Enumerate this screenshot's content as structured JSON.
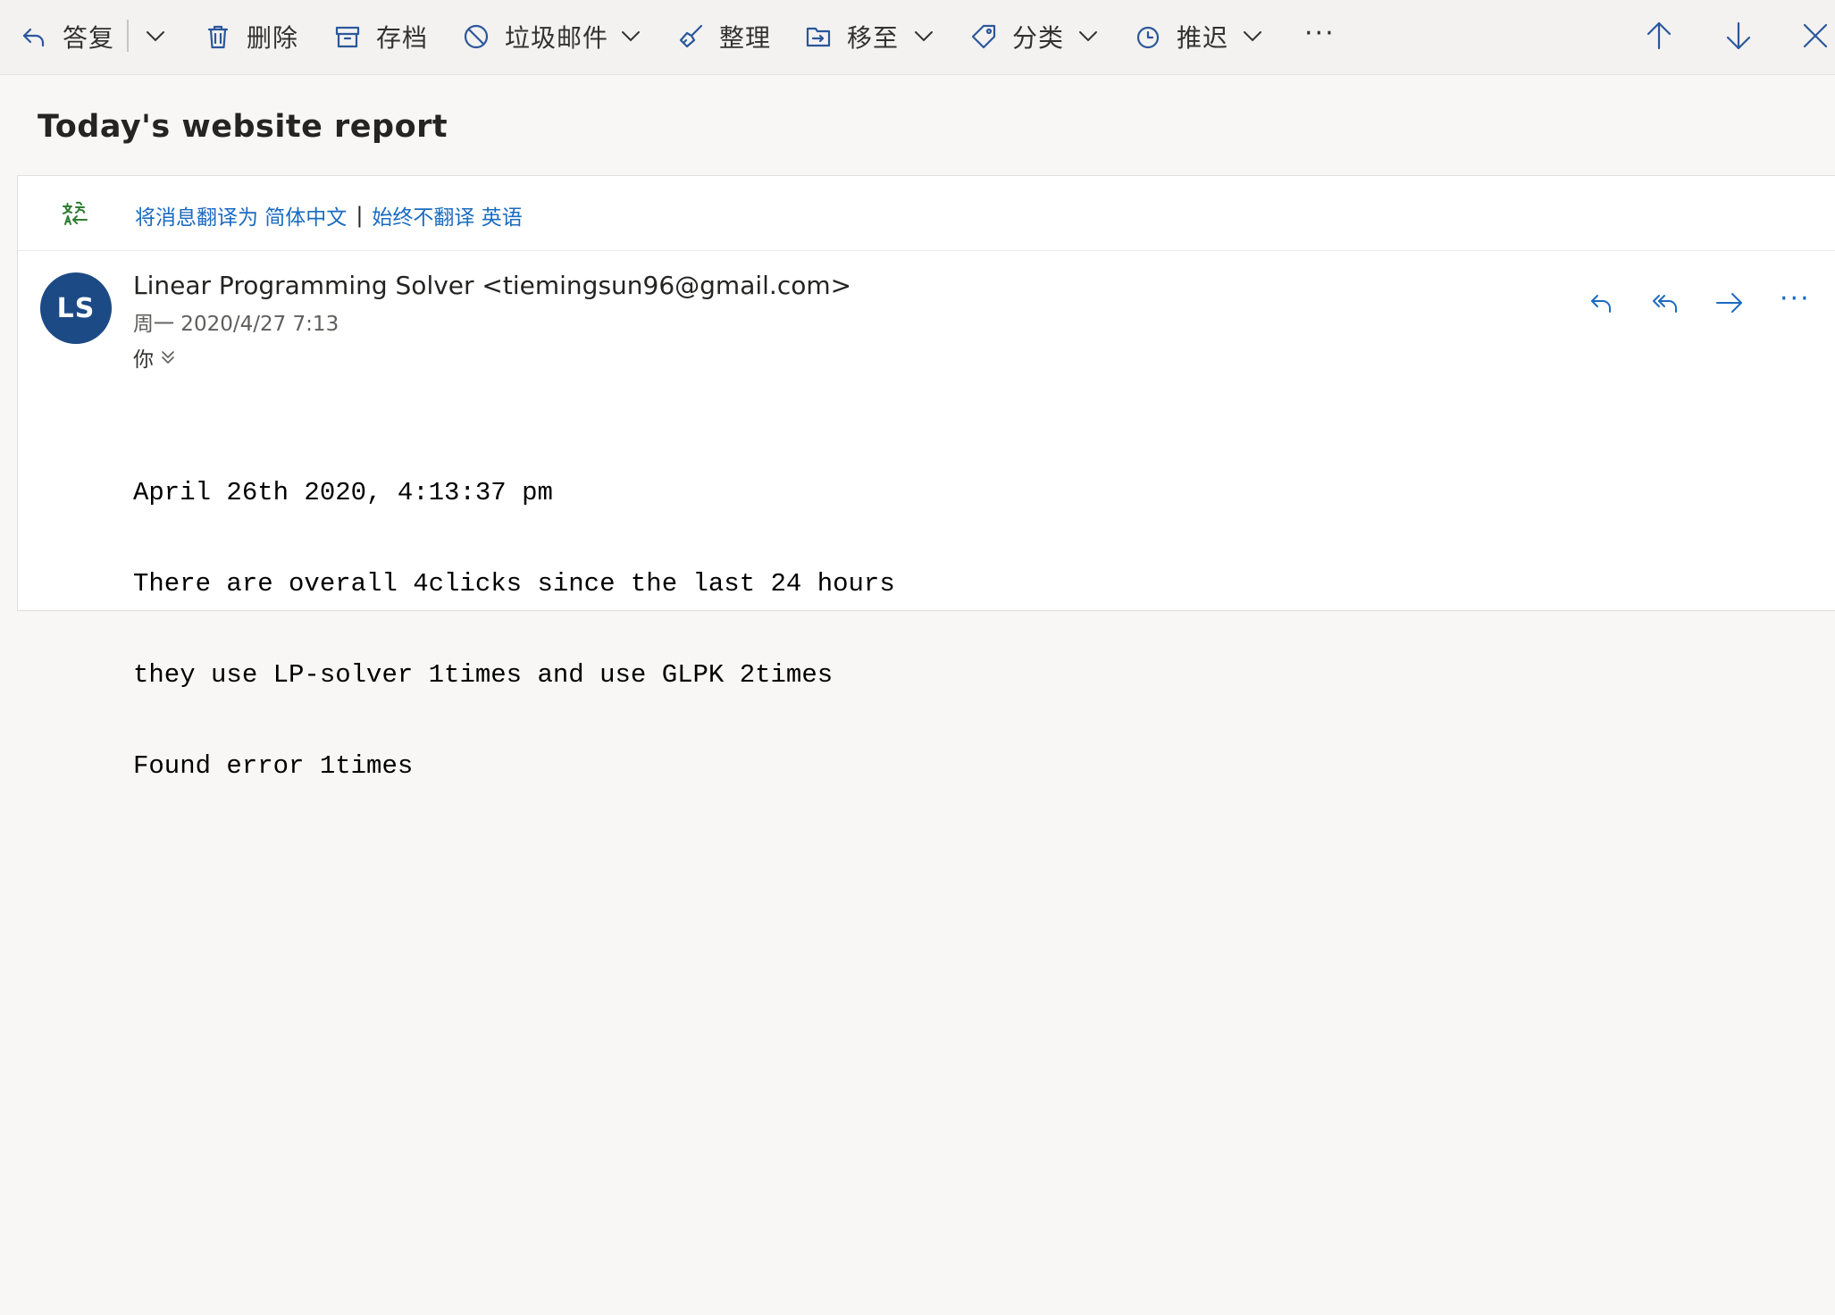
{
  "toolbar": {
    "reply_label": "答复",
    "delete_label": "删除",
    "archive_label": "存档",
    "junk_label": "垃圾邮件",
    "sweep_label": "整理",
    "move_label": "移至",
    "categorize_label": "分类",
    "snooze_label": "推迟",
    "more_label": "···"
  },
  "message": {
    "subject": "Today's website report",
    "translate": {
      "translate_link": "将消息翻译为 简体中文",
      "separator": "|",
      "never_link": "始终不翻译 英语"
    },
    "avatar_initials": "LS",
    "sender": "Linear Programming Solver <tiemingsun96@gmail.com>",
    "date": "周一 2020/4/27 7:13",
    "recipient": "你",
    "actions_more": "···",
    "body_lines": [
      "April 26th 2020, 4:13:37 pm",
      "There are overall 4clicks since the last 24 hours",
      "they use LP-solver 1times and use GLPK 2times",
      "Found error 1times"
    ]
  },
  "colors": {
    "accent": "#1a6bc1",
    "avatar_bg": "#1c4a85",
    "toolbar_icon": "#2b579a",
    "translate_icon": "#2e7d32"
  },
  "icons": {
    "reply": "reply-icon",
    "delete": "trash-icon",
    "archive": "archive-icon",
    "junk": "block-icon",
    "sweep": "broom-icon",
    "move": "move-to-folder-icon",
    "categorize": "tag-icon",
    "snooze": "clock-icon",
    "up": "arrow-up-icon",
    "down": "arrow-down-icon",
    "close": "close-icon",
    "translate": "translate-icon",
    "reply_all": "reply-all-icon",
    "forward": "forward-icon"
  }
}
